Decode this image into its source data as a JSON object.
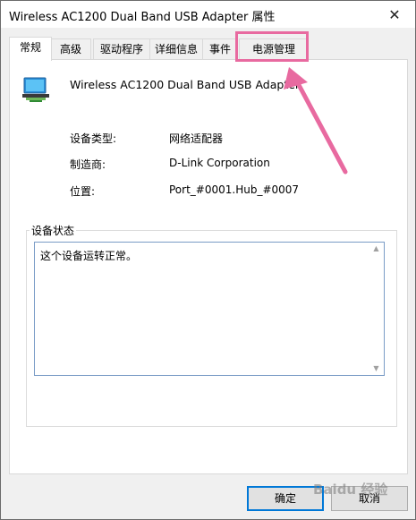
{
  "window": {
    "title": "Wireless AC1200 Dual Band USB Adapter 属性",
    "close_glyph": "✕"
  },
  "tabs": [
    {
      "label": "常规",
      "active": true
    },
    {
      "label": "高级",
      "active": false
    },
    {
      "label": "驱动程序",
      "active": false
    },
    {
      "label": "详细信息",
      "active": false
    },
    {
      "label": "事件",
      "active": false
    },
    {
      "label": "电源管理",
      "active": false
    }
  ],
  "device": {
    "name": "Wireless AC1200 Dual Band USB Adapter",
    "icon": "network-adapter-icon"
  },
  "properties": {
    "type_label": "设备类型:",
    "type_value": "网络适配器",
    "manufacturer_label": "制造商:",
    "manufacturer_value": "D-Link Corporation",
    "location_label": "位置:",
    "location_value": "Port_#0001.Hub_#0007"
  },
  "status": {
    "group_label": "设备状态",
    "text": "这个设备运转正常。"
  },
  "buttons": {
    "ok": "确定",
    "cancel": "取消"
  },
  "annotation": {
    "highlight_color": "#e86aa0"
  },
  "watermark": {
    "text": "Baidu 经验"
  }
}
